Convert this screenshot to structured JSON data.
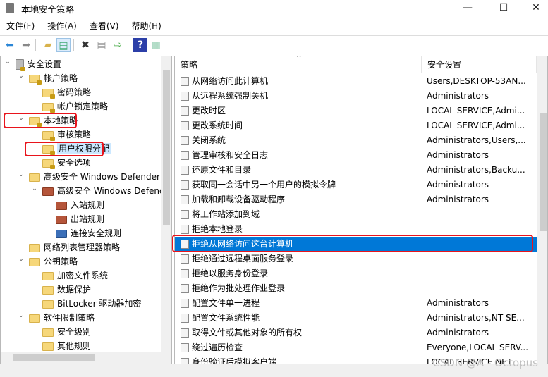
{
  "window": {
    "title": "本地安全策略",
    "minimize": "—",
    "maximize": "☐",
    "close": "✕"
  },
  "menu": [
    "文件(F)",
    "操作(A)",
    "查看(V)",
    "帮助(H)"
  ],
  "toolbar": [
    "back-icon",
    "forward-icon",
    "up-folder-icon",
    "show-hide-tree-icon",
    "delete-icon",
    "properties-icon",
    "export-list-icon",
    "help-icon",
    "action-pane-icon"
  ],
  "tree": [
    {
      "label": "安全设置",
      "level": 0,
      "expanded": true,
      "icon": "security-icon"
    },
    {
      "label": "帐户策略",
      "level": 1,
      "expanded": true,
      "icon": "folder-lock-icon"
    },
    {
      "label": "密码策略",
      "level": 2,
      "icon": "folder-lock-icon"
    },
    {
      "label": "帐户锁定策略",
      "level": 2,
      "icon": "folder-lock-icon"
    },
    {
      "label": "本地策略",
      "level": 1,
      "expanded": true,
      "icon": "folder-lock-icon"
    },
    {
      "label": "审核策略",
      "level": 2,
      "icon": "folder-lock-icon"
    },
    {
      "label": "用户权限分配",
      "level": 2,
      "icon": "folder-lock-icon",
      "selected": true
    },
    {
      "label": "安全选项",
      "level": 2,
      "icon": "folder-lock-icon"
    },
    {
      "label": "高级安全 Windows Defender 防火墙",
      "level": 1,
      "expanded": true,
      "icon": "folder-icon"
    },
    {
      "label": "高级安全 Windows Defender 防火墙 - 本地组策略对象",
      "level": 2,
      "expanded": true,
      "icon": "firewall-icon"
    },
    {
      "label": "入站规则",
      "level": 3,
      "icon": "inbound-rule-icon"
    },
    {
      "label": "出站规则",
      "level": 3,
      "icon": "outbound-rule-icon"
    },
    {
      "label": "连接安全规则",
      "level": 3,
      "icon": "connection-rule-icon"
    },
    {
      "label": "网络列表管理器策略",
      "level": 1,
      "icon": "folder-icon"
    },
    {
      "label": "公钥策略",
      "level": 1,
      "expanded": true,
      "icon": "folder-icon"
    },
    {
      "label": "加密文件系统",
      "level": 2,
      "icon": "folder-icon"
    },
    {
      "label": "数据保护",
      "level": 2,
      "icon": "folder-icon"
    },
    {
      "label": "BitLocker 驱动器加密",
      "level": 2,
      "icon": "folder-icon"
    },
    {
      "label": "软件限制策略",
      "level": 1,
      "expanded": true,
      "icon": "folder-icon"
    },
    {
      "label": "安全级别",
      "level": 2,
      "icon": "folder-icon"
    },
    {
      "label": "其他规则",
      "level": 2,
      "icon": "folder-icon"
    }
  ],
  "list": {
    "columns": [
      "策略",
      "安全设置"
    ],
    "rows": [
      {
        "name": "从网络访问此计算机",
        "setting": "Users,DESKTOP-53AN..."
      },
      {
        "name": "从远程系统强制关机",
        "setting": "Administrators"
      },
      {
        "name": "更改时区",
        "setting": "LOCAL SERVICE,Admi..."
      },
      {
        "name": "更改系统时间",
        "setting": "LOCAL SERVICE,Admi..."
      },
      {
        "name": "关闭系统",
        "setting": "Administrators,Users,..."
      },
      {
        "name": "管理审核和安全日志",
        "setting": "Administrators"
      },
      {
        "name": "还原文件和目录",
        "setting": "Administrators,Backu..."
      },
      {
        "name": "获取同一会话中另一个用户的模拟令牌",
        "setting": "Administrators"
      },
      {
        "name": "加载和卸载设备驱动程序",
        "setting": "Administrators"
      },
      {
        "name": "将工作站添加到域",
        "setting": ""
      },
      {
        "name": "拒绝本地登录",
        "setting": ""
      },
      {
        "name": "拒绝从网络访问这台计算机",
        "setting": "",
        "selected": true
      },
      {
        "name": "拒绝通过远程桌面服务登录",
        "setting": ""
      },
      {
        "name": "拒绝以服务身份登录",
        "setting": ""
      },
      {
        "name": "拒绝作为批处理作业登录",
        "setting": ""
      },
      {
        "name": "配置文件单一进程",
        "setting": "Administrators"
      },
      {
        "name": "配置文件系统性能",
        "setting": "Administrators,NT SE..."
      },
      {
        "name": "取得文件或其他对象的所有权",
        "setting": "Administrators"
      },
      {
        "name": "绕过遍历检查",
        "setting": "Everyone,LOCAL SERV..."
      },
      {
        "name": "身份验证后模拟客户端",
        "setting": "LOCAL SERVICE,NET..."
      }
    ]
  },
  "watermark": "CSDN @A - Octopus",
  "colors": {
    "selection": "#0078d7",
    "highlight_box": "#e8141c"
  }
}
